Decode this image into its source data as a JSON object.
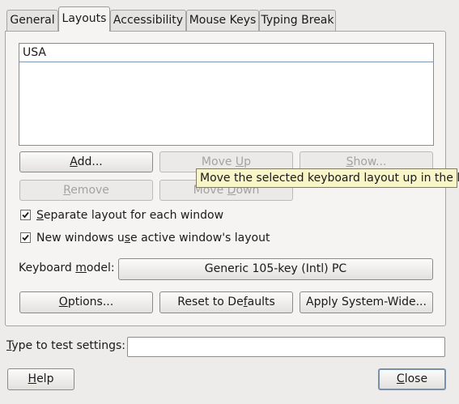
{
  "tabs": [
    {
      "label": "General",
      "active": false
    },
    {
      "label": "Layouts",
      "active": true
    },
    {
      "label": "Accessibility",
      "active": false
    },
    {
      "label": "Mouse Keys",
      "active": false
    },
    {
      "label": "Typing Break",
      "active": false
    }
  ],
  "layouts_list": {
    "items": [
      "USA"
    ]
  },
  "buttons": {
    "add": {
      "pre": "",
      "mn": "A",
      "post": "dd..."
    },
    "move_up": {
      "pre": "Move ",
      "mn": "U",
      "post": "p"
    },
    "show": {
      "pre": "",
      "mn": "S",
      "post": "how..."
    },
    "remove": {
      "pre": "",
      "mn": "R",
      "post": "emove"
    },
    "move_down": {
      "pre": "Move ",
      "mn": "D",
      "post": "own"
    },
    "options": {
      "pre": "",
      "mn": "O",
      "post": "ptions..."
    },
    "reset": {
      "pre": "Reset to De",
      "mn": "f",
      "post": "aults"
    },
    "apply": {
      "pre": "Apply System-Wide..."
    },
    "help": {
      "pre": "",
      "mn": "H",
      "post": "elp"
    },
    "close": {
      "pre": "",
      "mn": "C",
      "post": "lose"
    }
  },
  "checkboxes": [
    {
      "pre": "",
      "mn": "S",
      "post": "eparate layout for each window",
      "checked": true
    },
    {
      "pre": "New windows u",
      "mn": "s",
      "post": "e active window's layout",
      "checked": true
    }
  ],
  "keyboard_model": {
    "label_pre": "Keyboard ",
    "label_mn": "m",
    "label_post": "odel:",
    "value": "Generic 105-key (Intl) PC"
  },
  "test_settings": {
    "label_pre": "",
    "label_mn": "T",
    "label_post": "ype to test settings:",
    "value": ""
  },
  "tooltip": {
    "text": "Move the selected keyboard layout up in the list"
  },
  "colors": {
    "window_bg": "#edeceb",
    "tooltip_bg": "#f8f5c8",
    "list_separator": "#7f98b5"
  }
}
